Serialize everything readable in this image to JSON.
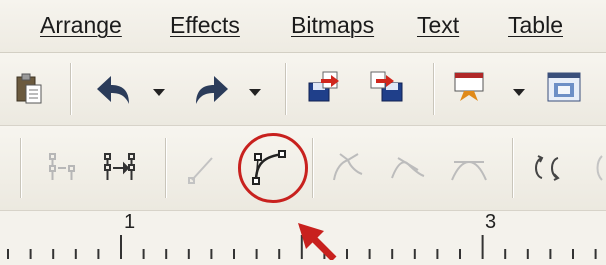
{
  "menu": {
    "arrange": "Arrange",
    "effects": "Effects",
    "bitmaps": "Bitmaps",
    "text": "Text",
    "table": "Table"
  },
  "standard_toolbar": {
    "icons": [
      "paste-icon",
      "undo-icon",
      "undo-dropdown-icon",
      "redo-icon",
      "redo-dropdown-icon",
      "import-icon",
      "export-icon",
      "application-launcher-icon",
      "launcher-dropdown-icon",
      "welcome-screen-icon"
    ]
  },
  "node_toolbar": {
    "icons": [
      "join-nodes-icon",
      "break-curve-icon",
      "convert-to-line-icon",
      "convert-to-curve-icon",
      "cusp-node-icon",
      "smooth-node-icon",
      "symmetrical-node-icon",
      "reverse-direction-icon"
    ]
  },
  "ruler": {
    "labels": [
      "1",
      "3"
    ]
  },
  "highlight": {
    "color": "#c8211e",
    "target": "convert-to-curve-icon"
  }
}
